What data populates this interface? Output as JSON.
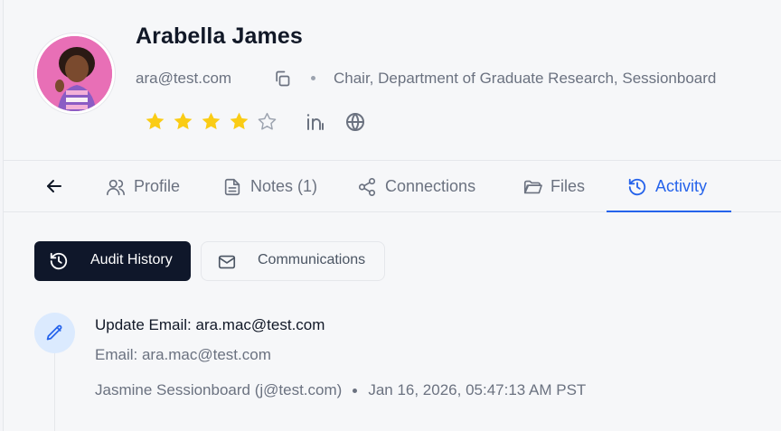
{
  "profile": {
    "name": "Arabella James",
    "email": "ara@test.com",
    "title": "Chair, Department of Graduate Research, Sessionboard",
    "rating": 4,
    "rating_max": 5,
    "star_color": "#facc15",
    "avatar_background": "#e86fb6"
  },
  "tabs": [
    {
      "label": "Profile",
      "icon": "users-icon"
    },
    {
      "label": "Notes (1)",
      "icon": "document-icon"
    },
    {
      "label": "Connections",
      "icon": "share-icon"
    },
    {
      "label": "Files",
      "icon": "folder-icon"
    },
    {
      "label": "Activity",
      "icon": "history-icon",
      "active": true
    }
  ],
  "subtabs": {
    "audit": "Audit History",
    "communications": "Communications"
  },
  "activity": [
    {
      "title": "Update Email: ara.mac@test.com",
      "detail": "Email: ara.mac@test.com",
      "actor": "Jasmine Sessionboard (j@test.com)",
      "timestamp": "Jan 16, 2026, 05:47:13 AM PST",
      "icon": "pencil-icon"
    }
  ],
  "colors": {
    "accent": "#2563eb",
    "primary_button": "#0f172a"
  }
}
